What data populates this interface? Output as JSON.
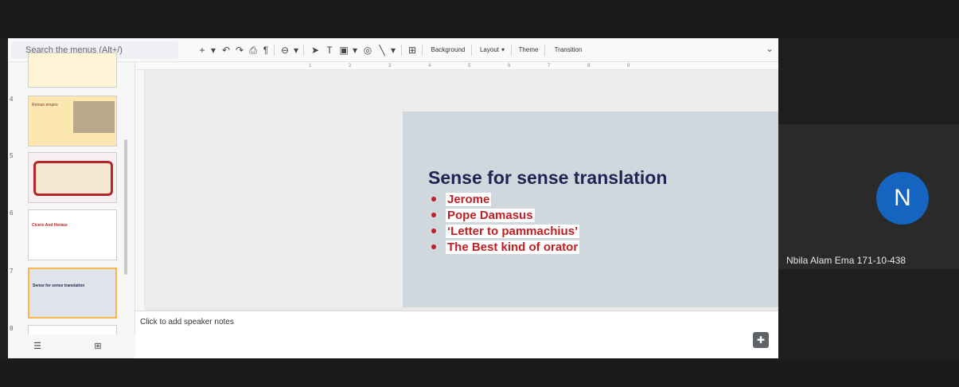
{
  "toolbar": {
    "search_placeholder": "Search the menus (Alt+/)",
    "background_label": "Background",
    "layout_label": "Layout",
    "theme_label": "Theme",
    "transition_label": "Transition",
    "icons": [
      "plus-icon",
      "undo-icon",
      "redo-icon",
      "print-icon",
      "paint-format-icon",
      "zoom-icon",
      "select-icon",
      "textbox-icon",
      "image-icon",
      "shape-icon",
      "line-icon",
      "comment-icon",
      "chevron-down-icon"
    ]
  },
  "ruler": {
    "numbers": [
      "1",
      "2",
      "3",
      "4",
      "5",
      "6",
      "7",
      "8",
      "9"
    ]
  },
  "thumbnails": [
    {
      "number": "4",
      "title": "Roman empire"
    },
    {
      "number": "5",
      "title": ""
    },
    {
      "number": "6",
      "title": "Cicero And Horace"
    },
    {
      "number": "7",
      "title": "Sense for sense translation",
      "selected": true
    },
    {
      "number": "8",
      "title": ""
    }
  ],
  "slide": {
    "title": "Sense for sense translation",
    "bullets": [
      "Jerome",
      "Pope Damasus",
      "‘Letter to pammachius’",
      "The Best kind of orator"
    ],
    "bullet_color": "#c11e23",
    "title_color": "#1f2452",
    "background_color": "#cfd8dc"
  },
  "notes": {
    "placeholder": "Click to add speaker notes"
  },
  "participant": {
    "initial": "N",
    "name": "Nbila Alam Ema 171-10-438",
    "avatar_color": "#1565c0"
  }
}
